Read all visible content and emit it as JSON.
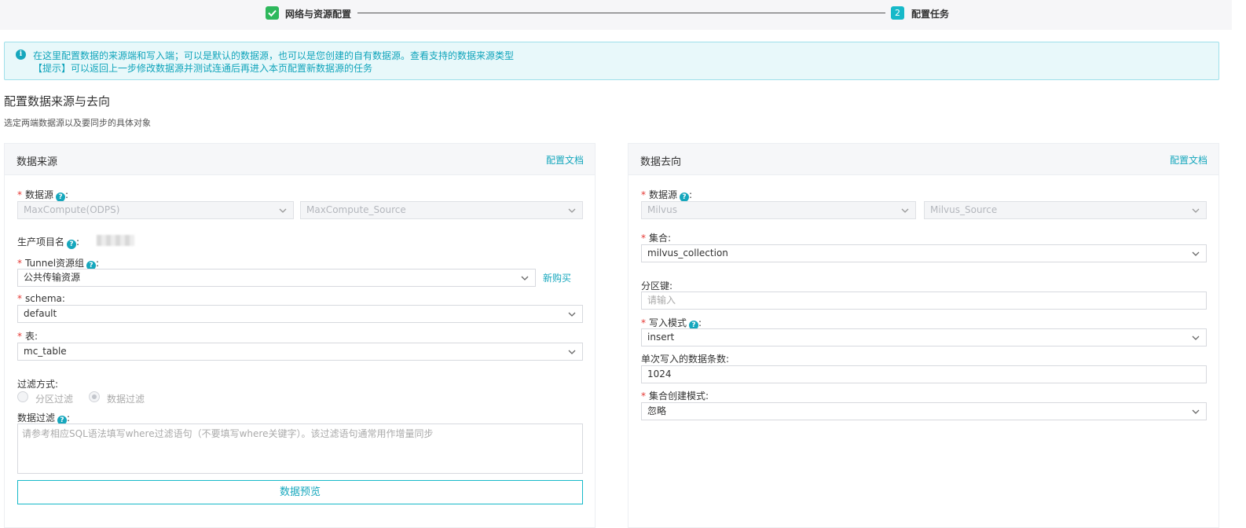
{
  "steps": [
    {
      "label": "网络与资源配置",
      "state": "done"
    },
    {
      "number": "2",
      "label": "配置任务",
      "state": "active"
    }
  ],
  "banner": {
    "line1": "在这里配置数据的来源端和写入端；可以是默认的数据源，也可以是您创建的自有数据源。查看支持的数据来源类型",
    "line2": "【提示】可以返回上一步修改数据源并测试连通后再进入本页配置新数据源的任务"
  },
  "section": {
    "title": "配置数据来源与去向",
    "desc": "选定两端数据源以及要同步的具体对象"
  },
  "source": {
    "title": "数据来源",
    "doc_link": "配置文档",
    "datasource_label": "数据源",
    "datasource_type": "MaxCompute(ODPS)",
    "datasource_name": "MaxCompute_Source",
    "project_label": "生产项目名",
    "tunnel_label": "Tunnel资源组",
    "tunnel_value": "公共传输资源",
    "tunnel_buy": "新购买",
    "schema_label": "schema",
    "schema_value": "default",
    "table_label": "表",
    "table_value": "mc_table",
    "filter_mode_label": "过滤方式:",
    "filter_options": [
      "分区过滤",
      "数据过滤"
    ],
    "filter_selected": "数据过滤",
    "data_filter_label": "数据过滤",
    "data_filter_placeholder": "请参考相应SQL语法填写where过滤语句（不要填写where关键字）。该过滤语句通常用作增量同步",
    "preview_button": "数据预览"
  },
  "target": {
    "title": "数据去向",
    "doc_link": "配置文档",
    "datasource_label": "数据源",
    "datasource_type": "Milvus",
    "datasource_name": "Milvus_Source",
    "collection_label": "集合",
    "collection_value": "milvus_collection",
    "partition_label": "分区键:",
    "partition_placeholder": "请输入",
    "write_mode_label": "写入模式",
    "write_mode_value": "insert",
    "batch_label": "单次写入的数据条数:",
    "batch_value": "1024",
    "create_mode_label": "集合创建模式",
    "create_mode_value": "忽略"
  },
  "colors": {
    "accent": "#16b9c9",
    "link": "#16a7bd",
    "success": "#2eb85c",
    "required": "#e53935"
  }
}
